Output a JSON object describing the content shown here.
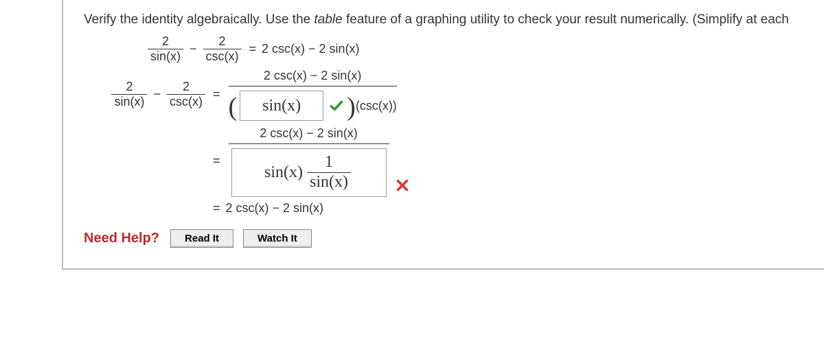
{
  "prompt": {
    "pre": "Verify the identity algebraically. Use the ",
    "table_word": "table",
    "post": " feature of a graphing utility to check your result numerically. (Simplify at each"
  },
  "identity": {
    "lhs": {
      "f1_num": "2",
      "f1_den": "sin(x)",
      "minus": "−",
      "f2_num": "2",
      "f2_den": "csc(x)"
    },
    "eq": "=",
    "rhs": "2 csc(x) − 2 sin(x)"
  },
  "step1": {
    "lhs": {
      "f1_num": "2",
      "f1_den": "sin(x)",
      "minus": "−",
      "f2_num": "2",
      "f2_den": "csc(x)"
    },
    "eq": "=",
    "paren_open": "(",
    "paren_close": ")",
    "numerator": "2 csc(x) − 2 sin(x)",
    "input_value": "sin(x)",
    "trailing": "(csc(x))",
    "status": "correct"
  },
  "step2": {
    "eq": "=",
    "numerator": "2 csc(x) − 2 sin(x)",
    "input_value": {
      "left": "sin(x)",
      "frac_num": "1",
      "frac_den": "sin(x)"
    },
    "status": "incorrect"
  },
  "step3": {
    "eq": "=",
    "rhs": "2 csc(x) − 2 sin(x)"
  },
  "help": {
    "label": "Need Help?",
    "read": "Read It",
    "watch": "Watch It"
  }
}
